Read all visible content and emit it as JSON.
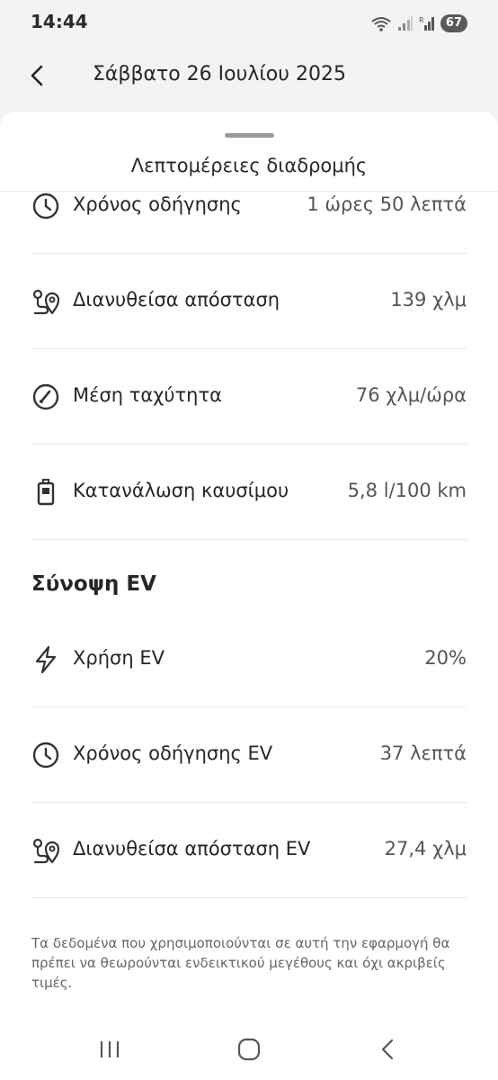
{
  "status_bar": {
    "time": "14:44",
    "battery": "67",
    "icons": [
      "wifi-icon",
      "signal-icon",
      "signal-roaming-icon"
    ]
  },
  "header": {
    "title": "Σάββατο 26 Ιουλίου 2025",
    "back_icon": "chevron-left-icon"
  },
  "sheet": {
    "title": "Λεπτομέρειες διαδρομής"
  },
  "trip_details": [
    {
      "icon": "clock-icon",
      "label": "Χρόνος οδήγησης",
      "value": "1 ώρες 50 λεπτά"
    },
    {
      "icon": "route-pin-icon",
      "label": "Διανυθείσα απόσταση",
      "value": "139 χλμ"
    },
    {
      "icon": "speedometer-icon",
      "label": "Μέση ταχύτητα",
      "value": "76 χλμ/ώρα"
    },
    {
      "icon": "fuel-pump-icon",
      "label": "Κατανάλωση καυσίμου",
      "value": "5,8 l/100 km"
    }
  ],
  "ev_summary": {
    "title": "Σύνοψη EV",
    "rows": [
      {
        "icon": "lightning-icon",
        "label": "Χρήση EV",
        "value": "20%"
      },
      {
        "icon": "clock-icon",
        "label": "Χρόνος οδήγησης EV",
        "value": "37 λεπτά"
      },
      {
        "icon": "route-pin-icon",
        "label": "Διανυθείσα απόσταση EV",
        "value": "27,4 χλμ"
      }
    ]
  },
  "disclaimer": "Τα δεδομένα που χρησιμοποιούνται σε αυτή την εφαρμογή θα πρέπει να θεωρούνται ενδεικτικού μεγέθους και όχι ακριβείς τιμές.",
  "nav_bar": {
    "icons": [
      "recent-apps-icon",
      "home-icon",
      "back-icon"
    ]
  }
}
